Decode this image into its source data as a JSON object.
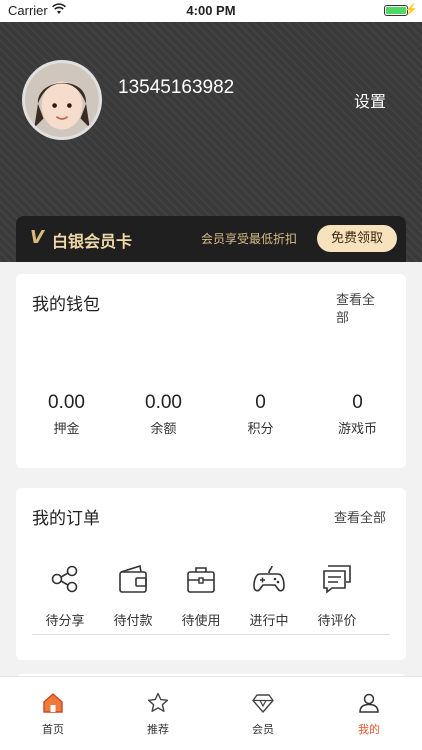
{
  "status_bar": {
    "carrier": "Carrier",
    "time": "4:00 PM"
  },
  "profile": {
    "phone": "13545163982",
    "settings_label": "设置"
  },
  "vip": {
    "badge": "V",
    "title": "白银会员卡",
    "desc": "会员享受最低折扣",
    "button": "免费领取"
  },
  "wallet": {
    "title": "我的钱包",
    "view_all": "查看全部",
    "items": [
      {
        "value": "0.00",
        "label": "押金"
      },
      {
        "value": "0.00",
        "label": "余额"
      },
      {
        "value": "0",
        "label": "积分"
      },
      {
        "value": "0",
        "label": "游戏币"
      }
    ]
  },
  "orders": {
    "title": "我的订单",
    "view_all": "查看全部",
    "items": [
      {
        "label": "待分享",
        "icon": "share-icon"
      },
      {
        "label": "待付款",
        "icon": "wallet-icon"
      },
      {
        "label": "待使用",
        "icon": "briefcase-icon"
      },
      {
        "label": "进行中",
        "icon": "gamepad-icon"
      },
      {
        "label": "待评价",
        "icon": "comment-icon"
      }
    ]
  },
  "tabs": [
    {
      "label": "首页",
      "icon": "home-icon"
    },
    {
      "label": "推荐",
      "icon": "star-icon"
    },
    {
      "label": "会员",
      "icon": "diamond-icon"
    },
    {
      "label": "我的",
      "icon": "user-icon",
      "active": true
    }
  ],
  "colors": {
    "accent": "#e8542a",
    "gold": "#f6e2bc",
    "header_bg": "#3a3a3a"
  }
}
